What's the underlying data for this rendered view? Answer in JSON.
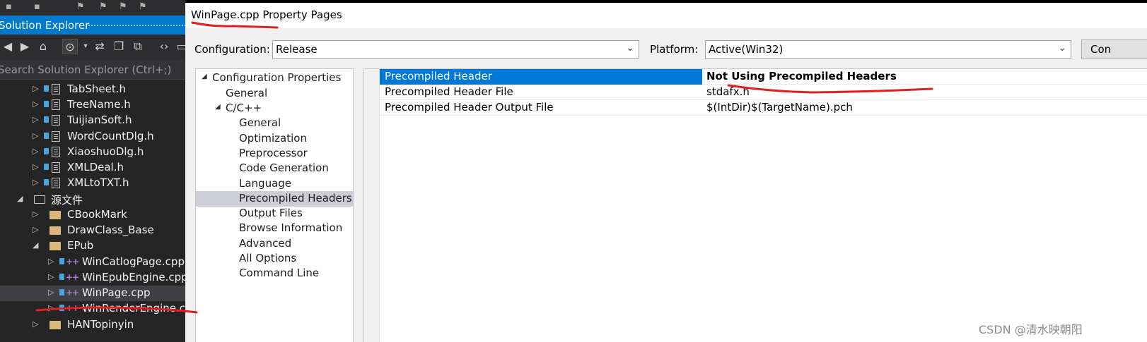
{
  "solution_explorer": {
    "title": "Solution Explorer",
    "search_placeholder": "Search Solution Explorer (Ctrl+;)",
    "items": [
      {
        "label": "TabSheet.h"
      },
      {
        "label": "TreeName.h"
      },
      {
        "label": "TuijianSoft.h"
      },
      {
        "label": "WordCountDlg.h"
      },
      {
        "label": "XiaoshuoDlg.h"
      },
      {
        "label": "XMLDeal.h"
      },
      {
        "label": "XMLtoTXT.h"
      },
      {
        "label": "源文件"
      },
      {
        "label": "CBookMark"
      },
      {
        "label": "DrawClass_Base"
      },
      {
        "label": "EPub"
      },
      {
        "label": "WinCatlogPage.cpp"
      },
      {
        "label": "WinEpubEngine.cpp"
      },
      {
        "label": "WinPage.cpp"
      },
      {
        "label": "WinRenderEngine.cp"
      },
      {
        "label": "HANTopinyin"
      }
    ]
  },
  "dialog": {
    "title": "WinPage.cpp Property Pages",
    "configuration_label": "Configuration:",
    "configuration_value": "Release",
    "platform_label": "Platform:",
    "platform_value": "Active(Win32)",
    "config_manager_button": "Con",
    "nav": [
      {
        "label": "Configuration Properties"
      },
      {
        "label": "General"
      },
      {
        "label": "C/C++"
      },
      {
        "label": "General"
      },
      {
        "label": "Optimization"
      },
      {
        "label": "Preprocessor"
      },
      {
        "label": "Code Generation"
      },
      {
        "label": "Language"
      },
      {
        "label": "Precompiled Headers"
      },
      {
        "label": "Output Files"
      },
      {
        "label": "Browse Information"
      },
      {
        "label": "Advanced"
      },
      {
        "label": "All Options"
      },
      {
        "label": "Command Line"
      }
    ],
    "properties": [
      {
        "name": "Precompiled Header",
        "value": "Not Using Precompiled Headers"
      },
      {
        "name": "Precompiled Header File",
        "value": "stdafx.h"
      },
      {
        "name": "Precompiled Header Output File",
        "value": "$(IntDir)$(TargetName).pch"
      }
    ]
  },
  "watermark": "CSDN @清水映朝阳",
  "colors": {
    "accent": "#007acc",
    "selection": "#0078d7",
    "annotation": "#e02020",
    "panel_dark": "#252526"
  }
}
